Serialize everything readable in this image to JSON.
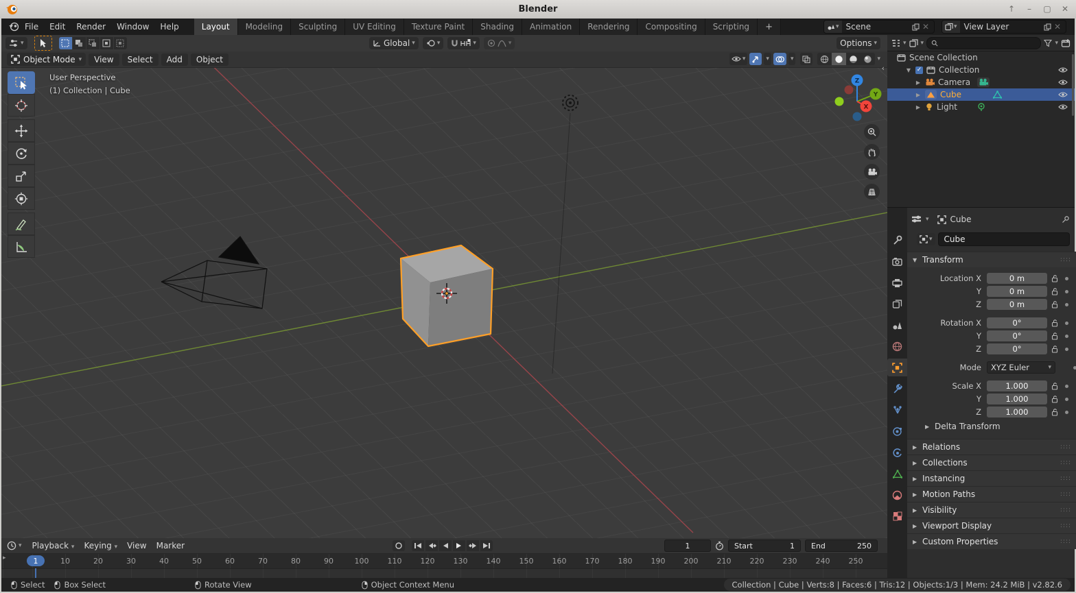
{
  "window": {
    "title": "Blender",
    "controls": {
      "shade": "↑",
      "minimize": "–",
      "maximize": "▢",
      "close": "✕"
    }
  },
  "colors": {
    "accent_blue": "#4772b3",
    "object_orange": "#ff9e2b",
    "selection_outline": "#ffa028",
    "axis_x": "#f2453b",
    "axis_y": "#73a815",
    "axis_z": "#3186e3",
    "active_text": "#ffaf38"
  },
  "topbar": {
    "menus": [
      "File",
      "Edit",
      "Render",
      "Window",
      "Help"
    ],
    "workspaces": [
      "Layout",
      "Modeling",
      "Sculpting",
      "UV Editing",
      "Texture Paint",
      "Shading",
      "Animation",
      "Rendering",
      "Compositing",
      "Scripting"
    ],
    "add_workspace": "+",
    "scene_label": "Scene",
    "view_layer_label": "View Layer"
  },
  "tool_header": {
    "orientation": "Global",
    "options": "Options"
  },
  "viewport": {
    "mode": "Object Mode",
    "menus": [
      "View",
      "Select",
      "Add",
      "Object"
    ],
    "overlay_line1": "User Perspective",
    "overlay_line2": "(1) Collection | Cube",
    "axis_labels": {
      "x": "X",
      "y": "Y",
      "z": "Z"
    }
  },
  "outliner": {
    "rows": [
      {
        "label": "Scene Collection"
      },
      {
        "label": "Collection"
      },
      {
        "label": "Camera"
      },
      {
        "label": "Cube"
      },
      {
        "label": "Light"
      }
    ]
  },
  "properties": {
    "breadcrumb": "Cube",
    "name_value": "Cube",
    "transform_title": "Transform",
    "rows": [
      {
        "label": "Location X",
        "value": "0 m"
      },
      {
        "label": "Y",
        "value": "0 m"
      },
      {
        "label": "Z",
        "value": "0 m"
      },
      {
        "label": "Rotation X",
        "value": "0°"
      },
      {
        "label": "Y",
        "value": "0°"
      },
      {
        "label": "Z",
        "value": "0°"
      },
      {
        "label": "Scale X",
        "value": "1.000"
      },
      {
        "label": "Y",
        "value": "1.000"
      },
      {
        "label": "Z",
        "value": "1.000"
      }
    ],
    "mode_label": "Mode",
    "mode_value": "XYZ Euler",
    "delta_panel": "Delta Transform",
    "panels": [
      "Relations",
      "Collections",
      "Instancing",
      "Motion Paths",
      "Visibility",
      "Viewport Display",
      "Custom Properties"
    ]
  },
  "timeline": {
    "menus": [
      "Playback",
      "Keying",
      "View",
      "Marker"
    ],
    "current_frame": "1",
    "start_label": "Start",
    "start_value": "1",
    "end_label": "End",
    "end_value": "250",
    "ruler": [
      "10",
      "20",
      "30",
      "40",
      "50",
      "60",
      "70",
      "80",
      "90",
      "100",
      "110",
      "120",
      "130",
      "140",
      "150",
      "160",
      "170",
      "180",
      "190",
      "200",
      "210",
      "220",
      "230",
      "240",
      "250"
    ]
  },
  "status": {
    "hints": [
      "Select",
      "Box Select",
      "Rotate View",
      "Object Context Menu"
    ],
    "stats": "Collection | Cube | Verts:8 | Faces:6 | Tris:12 | Objects:1/3 | Mem: 24.2 MiB | v2.82.6"
  }
}
